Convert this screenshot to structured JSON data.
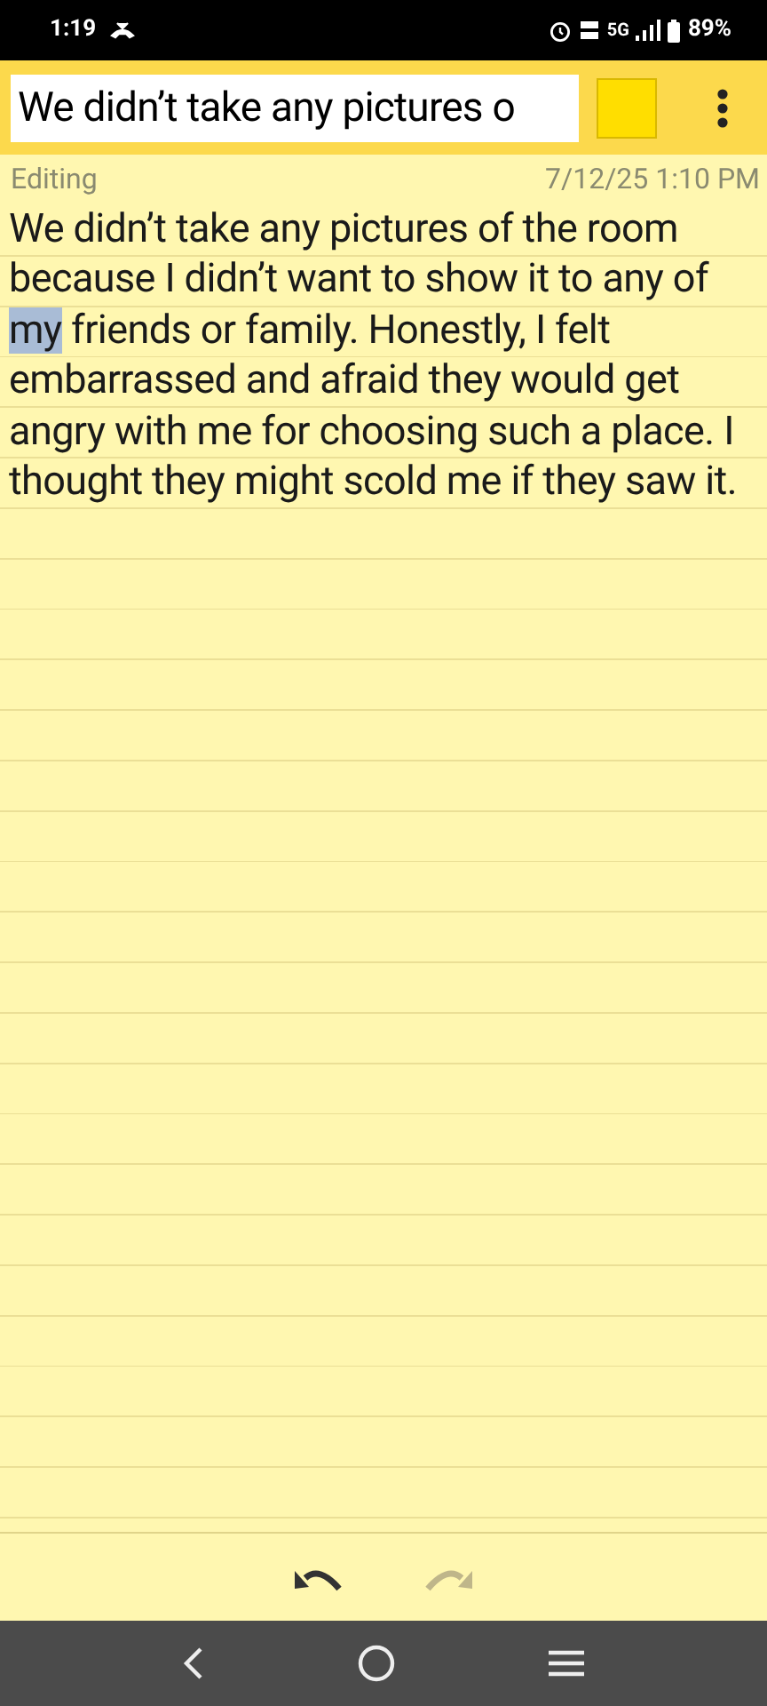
{
  "status_bar": {
    "time": "1:19",
    "network": "5G",
    "battery": "89%"
  },
  "toolbar": {
    "title": "We didn’t take any pictures o",
    "color": "#ffde00"
  },
  "info": {
    "mode": "Editing",
    "date": "7/12/25 1:10 PM"
  },
  "note": {
    "segments": [
      {
        "text": "We didn’t take any pictures of the room because I didn’t want to show it to any of ",
        "selected": false
      },
      {
        "text": "my",
        "selected": true
      },
      {
        "text": " friends or family. Honestly, I felt embarrassed and afraid they would get angry with me for choosing such a place. I thought they might scold me if they saw it.",
        "selected": false
      }
    ]
  },
  "edit_bar": {
    "undo": {
      "disabled": false
    },
    "redo": {
      "disabled": true
    }
  }
}
